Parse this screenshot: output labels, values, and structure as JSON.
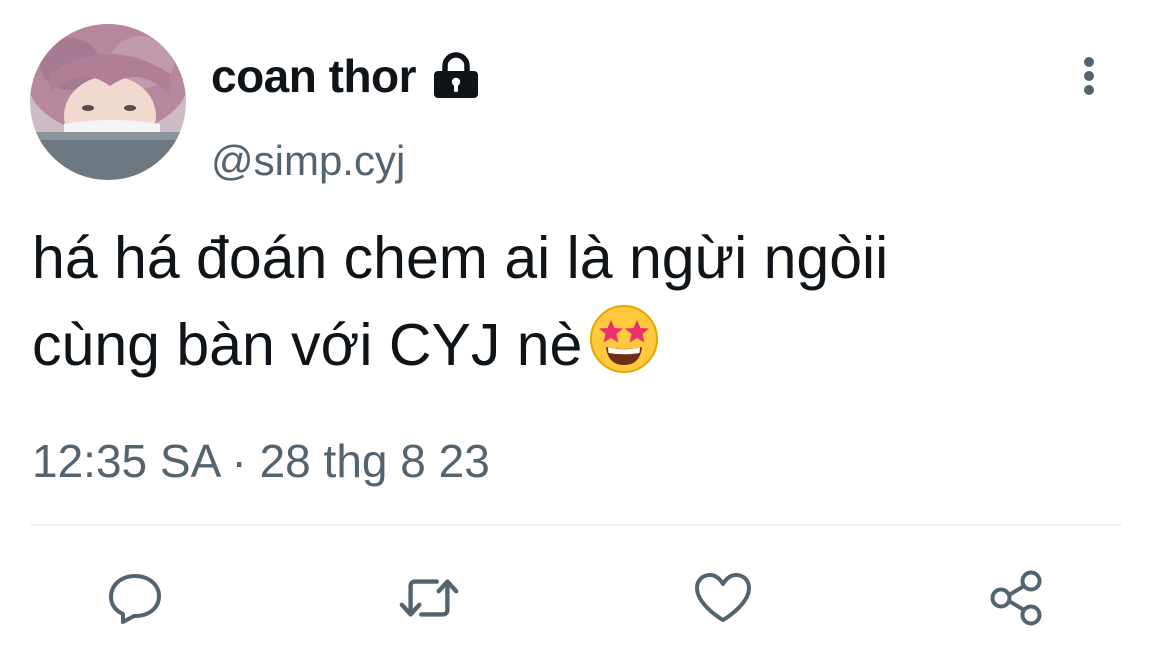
{
  "user": {
    "display_name": "coan thor",
    "handle": "@simp.cyj",
    "avatar_icon": "profile-photo",
    "locked_icon": "lock-icon"
  },
  "menu": {
    "icon": "more-vertical-icon"
  },
  "tweet": {
    "text_line1": "há há đoán chem ai là ngừi ngòii",
    "text_line2": "cùng bàn với CYJ nè",
    "emoji": "star-struck-emoji"
  },
  "meta": {
    "timestamp": "12:35 SA · 28 thg 8 23"
  },
  "actions": {
    "reply_icon": "comment-icon",
    "retweet_icon": "retweet-icon",
    "like_icon": "heart-icon",
    "share_icon": "share-icon"
  },
  "colors": {
    "text": "#0f1419",
    "secondary": "#536471",
    "divider": "#eff3f4",
    "icon": "#536471"
  }
}
